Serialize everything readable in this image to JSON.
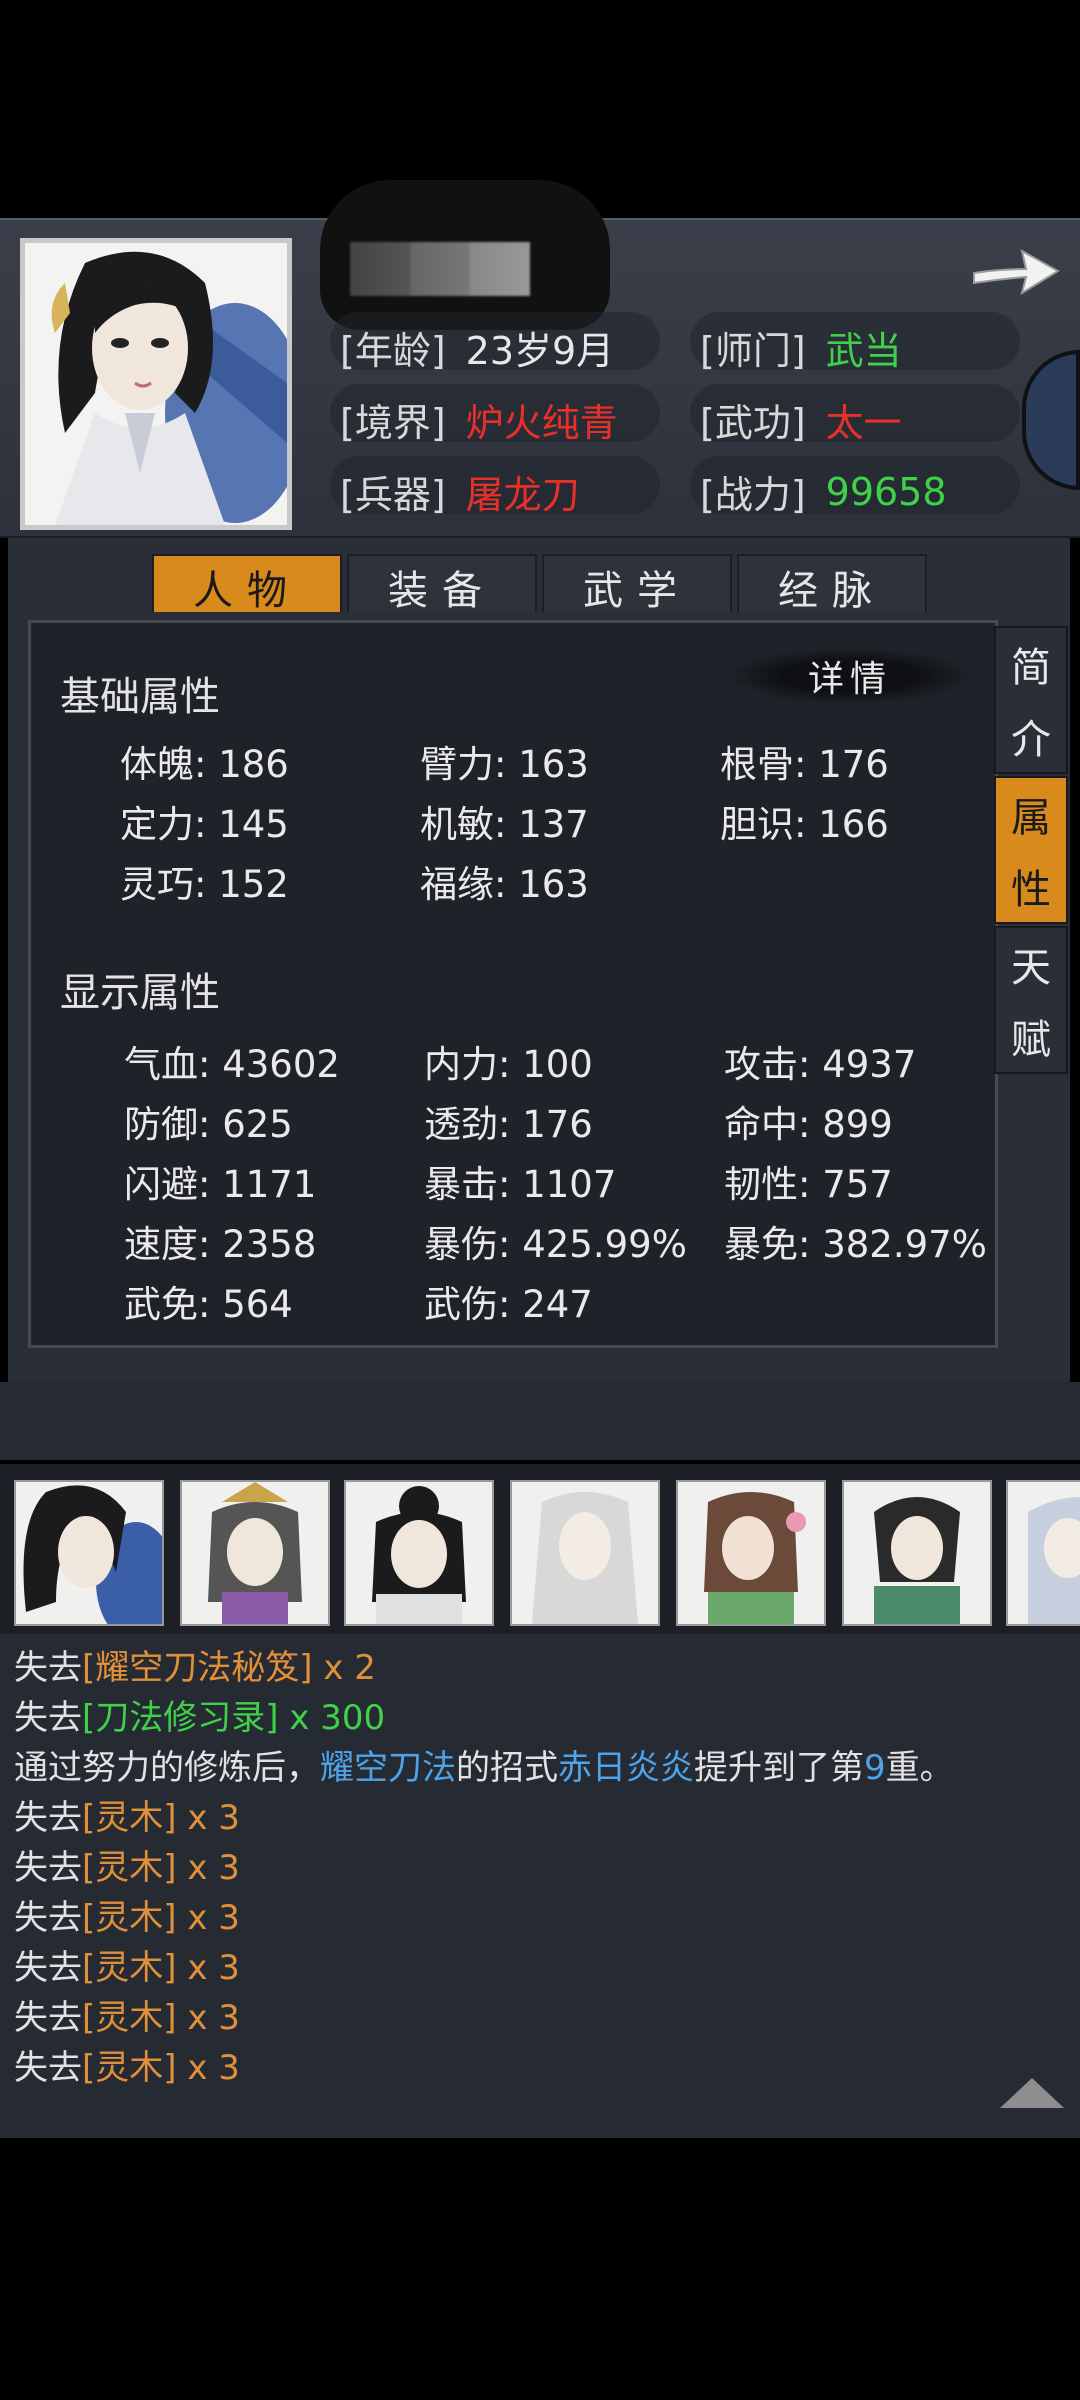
{
  "header": {
    "info": [
      {
        "label": "[年龄]",
        "value": "23岁9月",
        "color": "#e8e8e8"
      },
      {
        "label": "[师门]",
        "value": "武当",
        "color": "#3fd14a"
      },
      {
        "label": "[境界]",
        "value": "炉火纯青",
        "color": "#e8302a"
      },
      {
        "label": "[武功]",
        "value": "太一",
        "color": "#e8302a"
      },
      {
        "label": "[兵器]",
        "value": "屠龙刀",
        "color": "#e8302a"
      },
      {
        "label": "[战力]",
        "value": "99658",
        "color": "#3fd14a"
      }
    ]
  },
  "tabs": [
    "人物",
    "装备",
    "武学",
    "经脉"
  ],
  "active_tab": "人物",
  "side_tabs": [
    {
      "label": "简介",
      "chars": [
        "简",
        "介"
      ]
    },
    {
      "label": "属性",
      "chars": [
        "属",
        "性"
      ]
    },
    {
      "label": "天赋",
      "chars": [
        "天",
        "赋"
      ]
    }
  ],
  "active_side_tab": "属性",
  "panel": {
    "basic_title": "基础属性",
    "detail_label": "详情",
    "basic_stats": [
      "体魄: 186",
      "臂力: 163",
      "根骨: 176",
      "定力: 145",
      "机敏: 137",
      "胆识: 166",
      "灵巧: 152",
      "福缘: 163"
    ],
    "display_title": "显示属性",
    "display_stats": [
      "气血: 43602",
      "内力: 100",
      "攻击: 4937",
      "防御: 625",
      "透劲: 176",
      "命中: 899",
      "闪避: 1171",
      "暴击: 1107",
      "韧性: 757",
      "速度: 2358",
      "暴伤: 425.99%",
      "暴免: 382.97%",
      "武免: 564",
      "武伤: 247"
    ]
  },
  "log": {
    "lines": [
      [
        {
          "t": "失去",
          "c": ""
        },
        {
          "t": "[耀空刀法秘笈]",
          "c": "orange"
        },
        {
          "t": " x 2",
          "c": "orange"
        }
      ],
      [
        {
          "t": "失去",
          "c": ""
        },
        {
          "t": "[刀法修习录]",
          "c": "green"
        },
        {
          "t": " x 300",
          "c": "green"
        }
      ],
      [
        {
          "t": "通过努力的修炼后，",
          "c": ""
        },
        {
          "t": "耀空刀法",
          "c": "blue"
        },
        {
          "t": "的招式",
          "c": ""
        },
        {
          "t": "赤日炎炎",
          "c": "blue"
        },
        {
          "t": "提升到了第",
          "c": ""
        },
        {
          "t": "9",
          "c": "blue"
        },
        {
          "t": "重。",
          "c": ""
        }
      ],
      [
        {
          "t": "失去",
          "c": ""
        },
        {
          "t": "[灵木]",
          "c": "orange"
        },
        {
          "t": " x 3",
          "c": "orange"
        }
      ],
      [
        {
          "t": "失去",
          "c": ""
        },
        {
          "t": "[灵木]",
          "c": "orange"
        },
        {
          "t": " x 3",
          "c": "orange"
        }
      ],
      [
        {
          "t": "失去",
          "c": ""
        },
        {
          "t": "[灵木]",
          "c": "orange"
        },
        {
          "t": " x 3",
          "c": "orange"
        }
      ],
      [
        {
          "t": "失去",
          "c": ""
        },
        {
          "t": "[灵木]",
          "c": "orange"
        },
        {
          "t": " x 3",
          "c": "orange"
        }
      ],
      [
        {
          "t": "失去",
          "c": ""
        },
        {
          "t": "[灵木]",
          "c": "orange"
        },
        {
          "t": " x 3",
          "c": "orange"
        }
      ],
      [
        {
          "t": "失去",
          "c": ""
        },
        {
          "t": "[灵木]",
          "c": "orange"
        },
        {
          "t": " x 3",
          "c": "orange"
        }
      ]
    ]
  },
  "icons": {
    "next": "arrow-right-icon",
    "scroll_top": "triangle-up-icon"
  }
}
